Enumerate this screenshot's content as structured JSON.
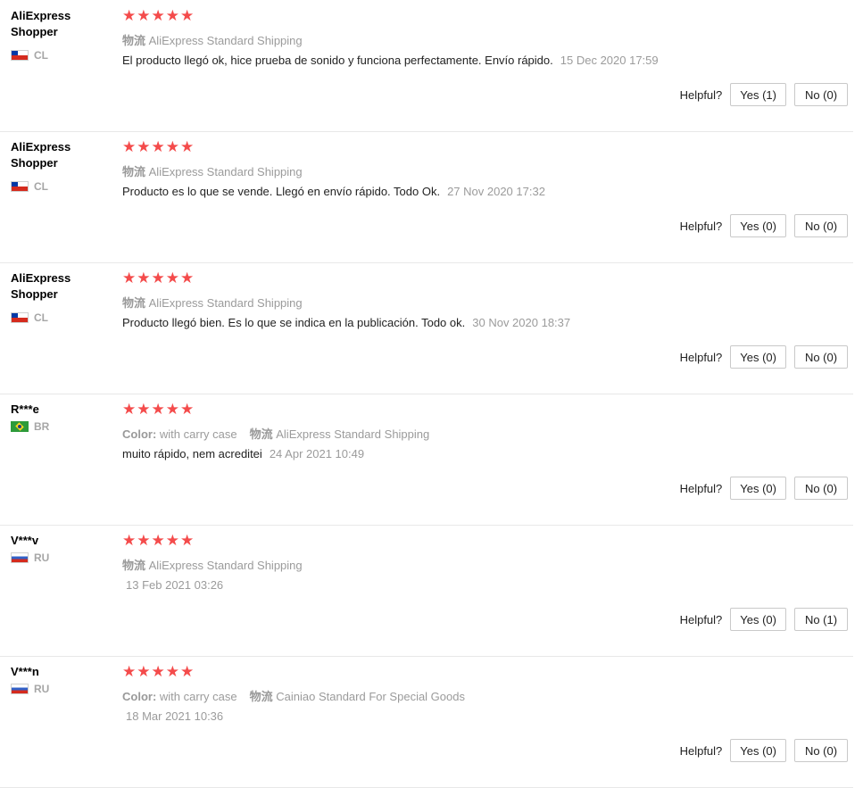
{
  "reviews": [
    {
      "user": "AliExpress Shopper",
      "country": "CL",
      "flag": "flag-cl",
      "color_label": "",
      "color_value": "",
      "logistics_label": "物流",
      "shipping": "AliExpress Standard Shipping",
      "text": "El producto llegó ok, hice prueba de sonido y funciona perfectamente. Envío rápido.",
      "date": "15 Dec 2020 17:59",
      "helpful_label": "Helpful?",
      "yes": "Yes (1)",
      "no": "No (0)"
    },
    {
      "user": "AliExpress Shopper",
      "country": "CL",
      "flag": "flag-cl",
      "color_label": "",
      "color_value": "",
      "logistics_label": "物流",
      "shipping": "AliExpress Standard Shipping",
      "text": "Producto es lo que se vende. Llegó en envío rápido. Todo Ok.",
      "date": "27 Nov 2020 17:32",
      "helpful_label": "Helpful?",
      "yes": "Yes (0)",
      "no": "No (0)"
    },
    {
      "user": "AliExpress Shopper",
      "country": "CL",
      "flag": "flag-cl",
      "color_label": "",
      "color_value": "",
      "logistics_label": "物流",
      "shipping": "AliExpress Standard Shipping",
      "text": "Producto llegó bien. Es lo que se indica en la publicación. Todo ok.",
      "date": "30 Nov 2020 18:37",
      "helpful_label": "Helpful?",
      "yes": "Yes (0)",
      "no": "No (0)"
    },
    {
      "user": "R***e",
      "country": "BR",
      "flag": "flag-br",
      "color_label": "Color:",
      "color_value": "with carry case",
      "logistics_label": "物流",
      "shipping": "AliExpress Standard Shipping",
      "text": "muito rápido, nem acreditei",
      "date": "24 Apr 2021 10:49",
      "helpful_label": "Helpful?",
      "yes": "Yes (0)",
      "no": "No (0)"
    },
    {
      "user": "V***v",
      "country": "RU",
      "flag": "flag-ru",
      "color_label": "",
      "color_value": "",
      "logistics_label": "物流",
      "shipping": "AliExpress Standard Shipping",
      "text": "",
      "date": "13 Feb 2021 03:26",
      "helpful_label": "Helpful?",
      "yes": "Yes (0)",
      "no": "No (1)"
    },
    {
      "user": "V***n",
      "country": "RU",
      "flag": "flag-ru",
      "color_label": "Color:",
      "color_value": "with carry case",
      "logistics_label": "物流",
      "shipping": "Cainiao Standard For Special Goods",
      "text": "",
      "date": "18 Mar 2021 10:36",
      "helpful_label": "Helpful?",
      "yes": "Yes (0)",
      "no": "No (0)"
    }
  ],
  "star_rating": 5,
  "star_glyph": "★",
  "star_color": "#f44b4b"
}
